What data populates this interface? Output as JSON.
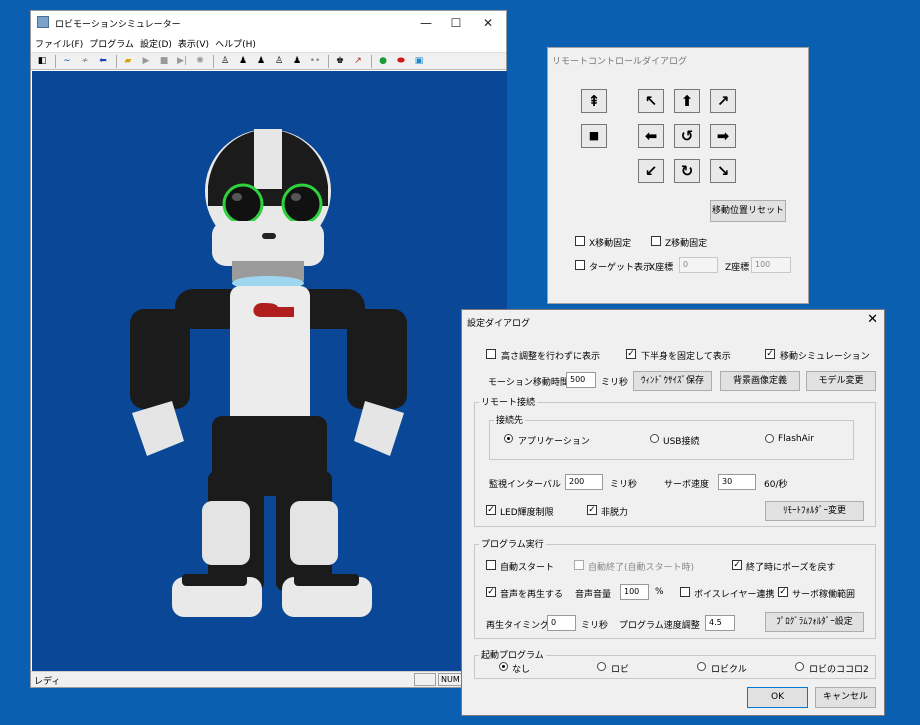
{
  "main": {
    "title": "ロビモーションシミュレーター",
    "menu": [
      "ファイル(F)",
      "プログラム",
      "設定(D)",
      "表示(V)",
      "ヘルプ(H)"
    ],
    "status": "レディ",
    "status_num": "NUM"
  },
  "remote": {
    "title": "リモートコントロールダイアログ",
    "reset_label": "移動位置リセット",
    "x_fixed_label": "X移動固定",
    "z_fixed_label": "Z移動固定",
    "target_label": "ターゲット表示",
    "x_coord_label": "X座標",
    "x_coord_value": "0",
    "z_coord_label": "Z座標",
    "z_coord_value": "100"
  },
  "settings": {
    "title": "設定ダイアログ",
    "no_height_label": "高さ調整を行わずに表示",
    "lower_fixed_label": "下半身を固定して表示",
    "move_sim_label": "移動シミュレーション",
    "motion_time_label": "モーション移動時間",
    "motion_time_value": "500",
    "ms_unit": "ミリ秒",
    "window_save_label": "ｳｨﾝﾄﾞｳｻｲｽﾞ保存",
    "bg_image_label": "背景画像定義",
    "model_change_label": "モデル変更",
    "remote_group": "リモート接続",
    "connect_group": "接続先",
    "opt_app": "アプリケーション",
    "opt_usb": "USB接続",
    "opt_flashair": "FlashAir",
    "monitor_label": "監視インターバル",
    "monitor_value": "200",
    "servo_speed_label": "サーボ速度",
    "servo_speed_value": "30",
    "servo_speed_unit": "60/秒",
    "led_label": "LED輝度制限",
    "nodetach_label": "非脱力",
    "remote_folder_label": "ﾘﾓｰﾄﾌｫﾙﾀﾞｰ変更",
    "program_group": "プログラム実行",
    "auto_start_label": "自動スタート",
    "auto_end_label": "自動終了(自動スタート時)",
    "pose_return_label": "終了時にポーズを戻す",
    "play_sound_label": "音声を再生する",
    "volume_label": "音声音量",
    "volume_value": "100",
    "percent": "%",
    "voice_layer_label": "ボイスレイヤー連携",
    "servo_range_label": "サーボ稼働範囲",
    "play_timing_label": "再生タイミング",
    "play_timing_value": "0",
    "program_speed_label": "プログラム速度調整",
    "program_speed_value": "4.5",
    "program_folder_label": "ﾌﾟﾛｸﾞﾗﾑﾌｫﾙﾀﾞｰ設定",
    "startup_group": "起動プログラム",
    "opt_none": "なし",
    "opt_robi": "ロビ",
    "opt_robikuru": "ロビクル",
    "opt_robikokoro": "ロビのココロ2",
    "ok_label": "OK",
    "cancel_label": "キャンセル"
  }
}
